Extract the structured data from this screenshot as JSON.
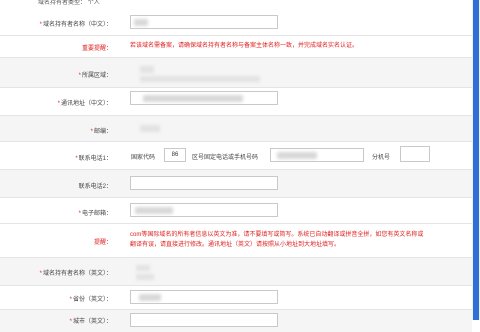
{
  "top_cut_label": "域名持有者类型：",
  "top_cut_value": "个人",
  "rows": {
    "holder_name_cn": {
      "label": "域名持有者名称（中文）："
    },
    "important_tip": {
      "label": "重要提醒：",
      "text": "若该域名需备案，请确保域名持有者名称与备案主体名称一致，并完成域名实名认证。"
    },
    "region": {
      "label": "所属区域："
    },
    "address_cn": {
      "label": "通讯地址（中文）："
    },
    "zip": {
      "label": "邮编："
    },
    "phone1": {
      "label": "联系电话1：",
      "country_code_label": "国家代码",
      "country_code_value": "86",
      "area_label": "区号固定电话或手机号码",
      "ext_label": "分机号"
    },
    "phone2": {
      "label": "联系电话2："
    },
    "email": {
      "label": "电子邮箱："
    },
    "notice": {
      "label": "提醒：",
      "text_line1": "com等国际域名的所有者信息以英文为准，请不要填写或简写。系统已自动翻译或拼音全拼，如您有英文名称或",
      "text_line2": "翻译有误，请直接进行修改。通讯地址（英文）请按照从小地址到大地址填写。"
    },
    "holder_name_en": {
      "label": "域名持有者名称（英文）："
    },
    "province_en": {
      "label": "省份（英文）："
    },
    "city_en": {
      "label": "城市（英文）："
    }
  },
  "colors": {
    "required": "#e02020",
    "scroll_thumb": "#2f6fd8",
    "alt_row": "#f5f5f5"
  }
}
